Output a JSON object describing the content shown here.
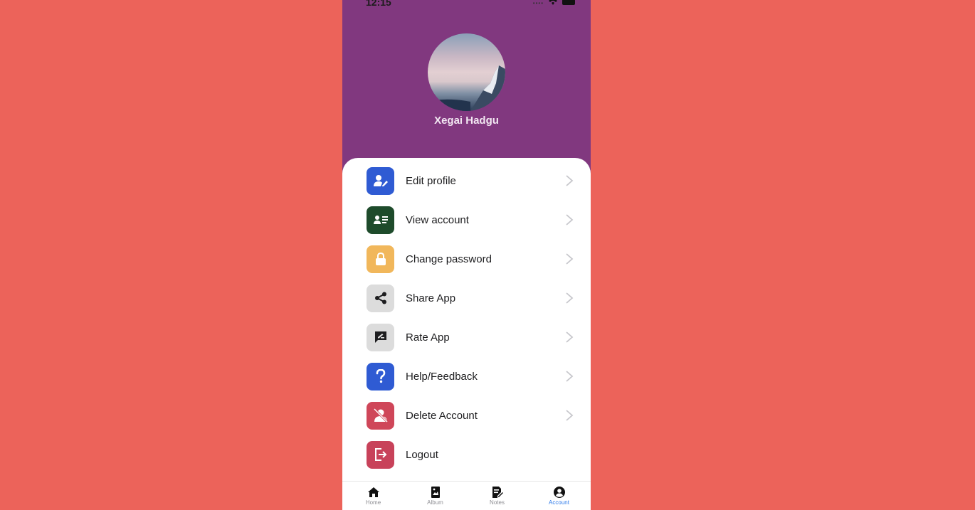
{
  "status_bar": {
    "time": "12:15"
  },
  "profile": {
    "name": "Xegai Hadgu"
  },
  "menu": [
    {
      "label": "Edit profile",
      "icon": "edit-profile-icon",
      "color": "#2F5BD3",
      "has_chevron": true
    },
    {
      "label": "View account",
      "icon": "contact-card-icon",
      "color": "#1E4B2B",
      "has_chevron": true
    },
    {
      "label": "Change password",
      "icon": "lock-icon",
      "color": "#F1B75B",
      "has_chevron": true
    },
    {
      "label": "Share App",
      "icon": "share-icon",
      "color": "#DCDCDC",
      "has_chevron": true
    },
    {
      "label": "Rate App",
      "icon": "rate-icon",
      "color": "#DCDCDC",
      "has_chevron": true
    },
    {
      "label": "Help/Feedback",
      "icon": "question-icon",
      "color": "#2F5BD3",
      "has_chevron": true
    },
    {
      "label": "Delete Account",
      "icon": "delete-user-icon",
      "color": "#CF4659",
      "has_chevron": true
    },
    {
      "label": "Logout",
      "icon": "logout-icon",
      "color": "#C8425A",
      "has_chevron": false
    }
  ],
  "tabs": [
    {
      "label": "Home",
      "icon": "home-icon",
      "active": false
    },
    {
      "label": "Album",
      "icon": "album-icon",
      "active": false
    },
    {
      "label": "Notes",
      "icon": "notes-icon",
      "active": false
    },
    {
      "label": "Account",
      "icon": "account-icon",
      "active": true
    }
  ],
  "colors": {
    "page_bg": "#EC635A",
    "header_bg": "#81387F",
    "active_tab": "#2F7BEA"
  }
}
